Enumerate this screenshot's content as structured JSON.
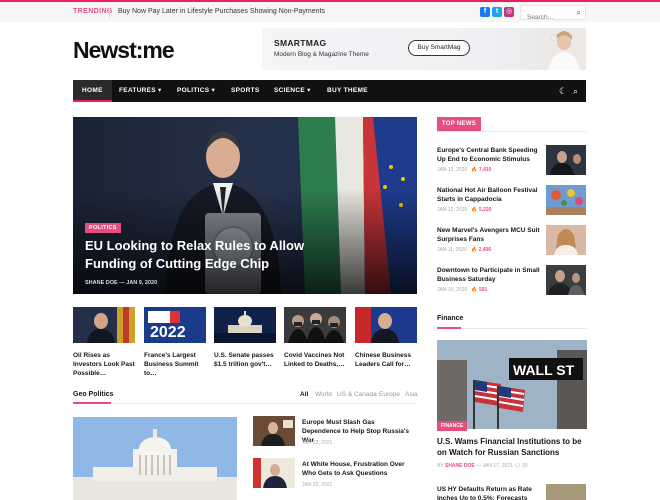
{
  "topbar": {
    "trending_label": "TRENDING",
    "trending_headline": "Buy Now Pay Later in Lifestyle Purchases Showing Non-Payments",
    "social": {
      "facebook": "f",
      "twitter": "t",
      "instagram": "◎"
    },
    "search_placeholder": "Search..."
  },
  "header": {
    "logo": "Newst:me",
    "ad": {
      "title": "SMARTMAG",
      "subtitle": "Modern Blog & Magazine Theme",
      "button": "Buy SmartMag"
    }
  },
  "nav": {
    "items": [
      "HOME",
      "FEATURES ▾",
      "POLITICS ▾",
      "SPORTS",
      "SCIENCE ▾",
      "BUY THEME"
    ],
    "dark_mode_icon": "☾",
    "search_icon": "⌕"
  },
  "hero": {
    "category": "POLITICS",
    "title": "EU Looking to Relax Rules to Allow Funding of Cutting Edge Chip",
    "meta": "SHANE DOE  —  JAN 9, 2020"
  },
  "thumbs": [
    {
      "title": "Oil Rises as Investors Look Past Possible…"
    },
    {
      "title": "France's Largest Business Summit to…",
      "image_text": "2022"
    },
    {
      "title": "U.S. Senate passes $1.5 trillion gov't…"
    },
    {
      "title": "Covid Vaccines Not Linked to Deaths,…"
    },
    {
      "title": "Chinese Business Leaders Call for…"
    }
  ],
  "geo": {
    "title": "Geo Politics",
    "tabs": [
      "All",
      "World",
      "US & Canada",
      "Europe",
      "Asia"
    ],
    "items": [
      {
        "title": "Europe Must Slash Gas Dependence to Help Stop Russia's War",
        "date": "JAN 22, 2021"
      },
      {
        "title": "At White House, Frustration Over Who Gets to Ask Questions",
        "date": "JAN 22, 2021"
      }
    ]
  },
  "top_news": {
    "label": "TOP NEWS",
    "items": [
      {
        "title": "Europe's Central Bank Speeding Up End to Economic Stimulus",
        "date": "JAN 13, 2020",
        "views": "7,410"
      },
      {
        "title": "National Hot Air Balloon Festival Starts in Cappadocia",
        "date": "JAN 12, 2020",
        "views": "5,220"
      },
      {
        "title": "New Marvel's Avengers MCU Suit Surprises Fans",
        "date": "JAN 11, 2020",
        "views": "2,406"
      },
      {
        "title": "Downtown to Participate in Small Business Saturday",
        "date": "JAN 10, 2020",
        "views": "501"
      }
    ]
  },
  "finance": {
    "title": "Finance",
    "category": "FINANCE",
    "sign_text": "WALL ST",
    "headline": "U.S. Wams Financial Institutions to be on Watch for Russian Sanctions",
    "by": "BY",
    "author": "SHANE DOE",
    "date": "JAN 17, 2021",
    "comments": "30",
    "second_title": "US HY Defaults Return as Rate Inches Up to 0.5%; Forecasts"
  },
  "colors": {
    "accent": "#e54e7e",
    "nav_bg": "#111111"
  }
}
